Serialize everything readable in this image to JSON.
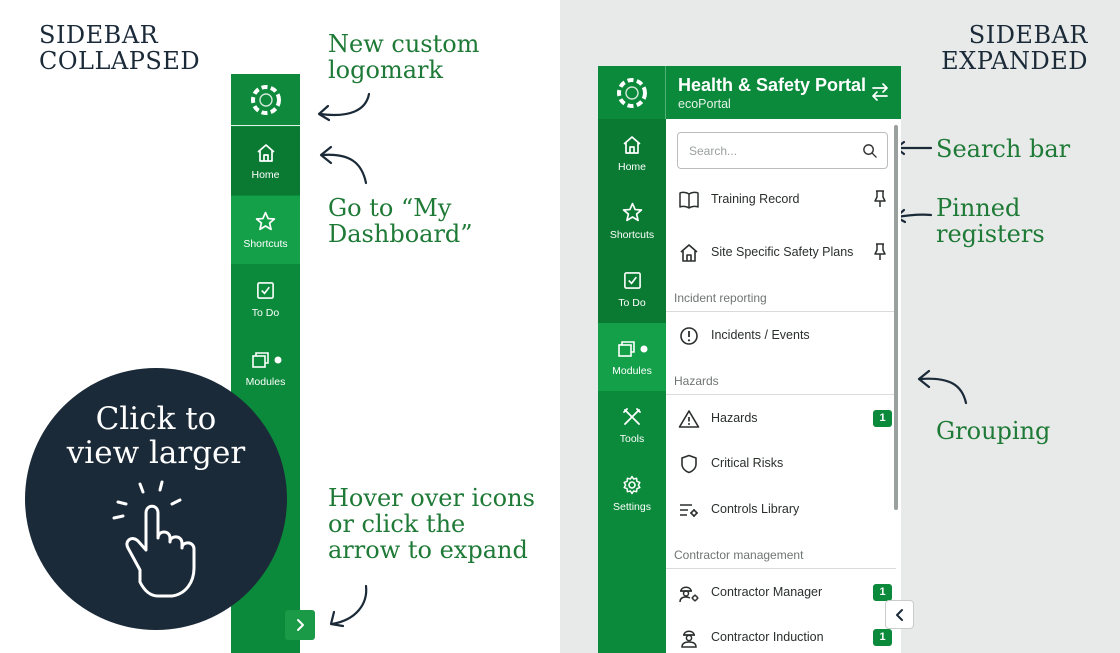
{
  "left": {
    "title_line1": "SIDEBAR",
    "title_line2": "COLLAPSED",
    "annotations": {
      "logomark_1": "New custom",
      "logomark_2": "logomark",
      "dashboard_1": "Go to “My",
      "dashboard_2": "Dashboard”",
      "hover_1": "Hover over icons",
      "hover_2": "or click the",
      "hover_3": "arrow to expand"
    },
    "nav": {
      "home": "Home",
      "shortcuts": "Shortcuts",
      "todo": "To Do",
      "modules": "Modules"
    },
    "badge_1": "Click to",
    "badge_2": "view larger"
  },
  "right": {
    "title_line1": "SIDEBAR",
    "title_line2": "EXPANDED",
    "header": {
      "title": "Health & Safety Portal",
      "subtitle": "ecoPortal"
    },
    "rail": {
      "home": "Home",
      "shortcuts": "Shortcuts",
      "todo": "To Do",
      "modules": "Modules",
      "tools": "Tools",
      "settings": "Settings"
    },
    "search": {
      "placeholder": "Search..."
    },
    "pinned": [
      "Training Record",
      "Site Specific Safety Plans"
    ],
    "groups": {
      "incident": "Incident reporting",
      "hazards": "Hazards",
      "contractor": "Contractor management"
    },
    "items": {
      "incidents": "Incidents / Events",
      "hazards": "Hazards",
      "hazards_count": "1",
      "critical_risks": "Critical Risks",
      "controls_library": "Controls Library",
      "contractor_manager": "Contractor Manager",
      "contractor_manager_count": "1",
      "contractor_induction": "Contractor Induction",
      "contractor_induction_count": "1"
    },
    "annotations": {
      "search_bar": "Search bar",
      "pinned_1": "Pinned",
      "pinned_2": "registers",
      "grouping": "Grouping"
    }
  },
  "colors": {
    "brand_green": "#0b8a3b",
    "annotation_green": "#1e7a36",
    "navy": "#1b2a38",
    "right_background": "#e8eae9"
  }
}
